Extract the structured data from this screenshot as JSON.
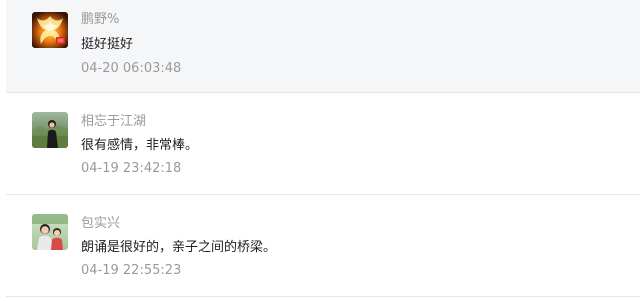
{
  "comments": [
    {
      "username": "鹏野%",
      "content": "挺好挺好",
      "time": "04-20 06:03:48",
      "avatar_icon": "phoenix-avatar-icon"
    },
    {
      "username": "相忘于江湖",
      "content": "很有感情，非常棒。",
      "time": "04-19 23:42:18",
      "avatar_icon": "person-photo-avatar-icon"
    },
    {
      "username": "包实兴",
      "content": "朗诵是很好的，亲子之间的桥梁。",
      "time": "04-19 22:55:23",
      "avatar_icon": "person-photo-avatar-icon"
    }
  ]
}
